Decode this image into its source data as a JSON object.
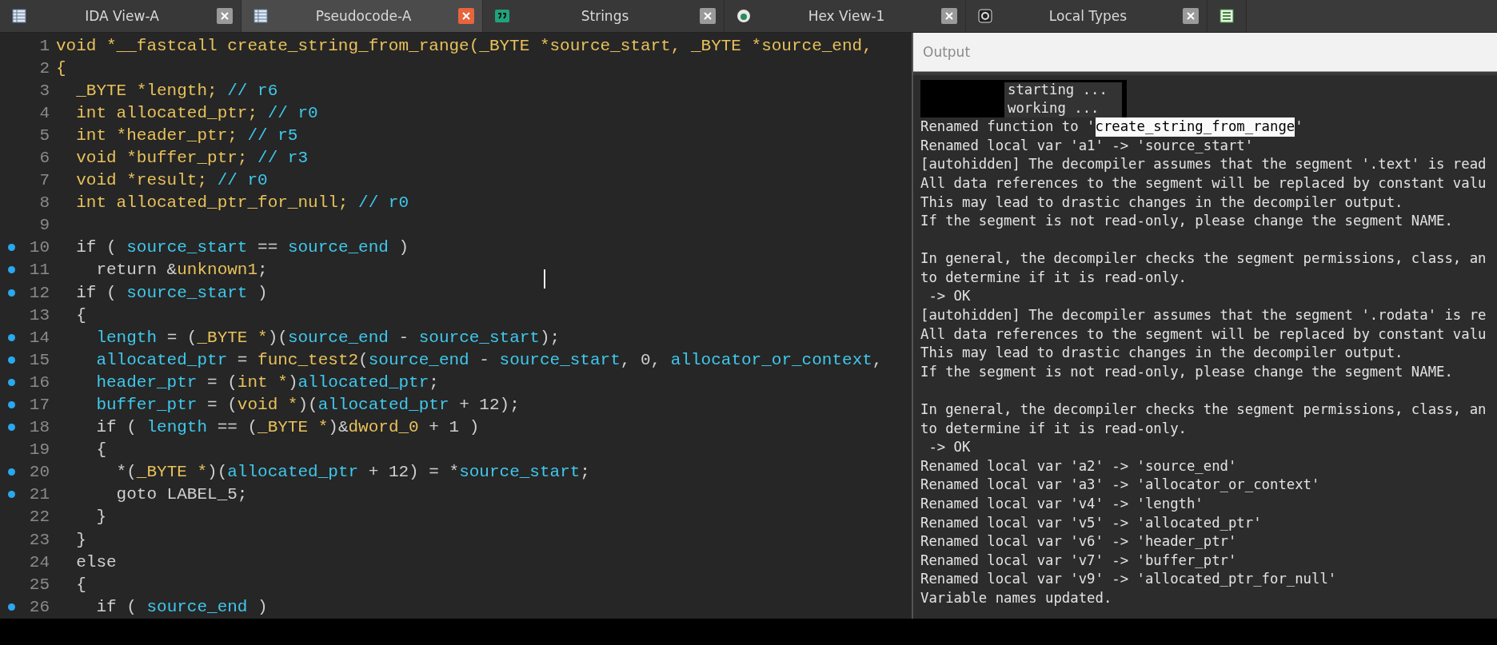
{
  "tabs": [
    {
      "label": "IDA View-A",
      "selected": false
    },
    {
      "label": "Pseudocode-A",
      "selected": true
    },
    {
      "label": "Strings",
      "selected": false
    },
    {
      "label": "Hex View-1",
      "selected": false
    },
    {
      "label": "Local Types",
      "selected": false
    },
    {
      "selected": false
    }
  ],
  "code": {
    "lines": [
      {
        "number": "1",
        "marked": false,
        "tokens": [
          {
            "kind": "type",
            "text": "void *__fastcall create_string_from_range(_BYTE *source_start, _BYTE *source_end,"
          }
        ]
      },
      {
        "number": "2",
        "marked": false,
        "tokens": [
          {
            "kind": "type",
            "text": "{"
          }
        ]
      },
      {
        "number": "3",
        "marked": false,
        "tokens": [
          {
            "kind": "type",
            "text": "  _BYTE *length; "
          },
          {
            "kind": "comment",
            "text": "// r6"
          }
        ]
      },
      {
        "number": "4",
        "marked": false,
        "tokens": [
          {
            "kind": "type",
            "text": "  int allocated_ptr; "
          },
          {
            "kind": "comment",
            "text": "// r0"
          }
        ]
      },
      {
        "number": "5",
        "marked": false,
        "tokens": [
          {
            "kind": "type",
            "text": "  int *header_ptr; "
          },
          {
            "kind": "comment",
            "text": "// r5"
          }
        ]
      },
      {
        "number": "6",
        "marked": false,
        "tokens": [
          {
            "kind": "type",
            "text": "  void *buffer_ptr; "
          },
          {
            "kind": "comment",
            "text": "// r3"
          }
        ]
      },
      {
        "number": "7",
        "marked": false,
        "tokens": [
          {
            "kind": "type",
            "text": "  void *result; "
          },
          {
            "kind": "comment",
            "text": "// r0"
          }
        ]
      },
      {
        "number": "8",
        "marked": false,
        "tokens": [
          {
            "kind": "type",
            "text": "  int allocated_ptr_for_null; "
          },
          {
            "kind": "comment",
            "text": "// r0"
          }
        ]
      },
      {
        "number": "9",
        "marked": false
      },
      {
        "number": "10",
        "marked": true,
        "tokens": [
          {
            "kind": "plain",
            "text": "  if ( "
          },
          {
            "kind": "var",
            "text": "source_start"
          },
          {
            "kind": "plain",
            "text": " == "
          },
          {
            "kind": "var",
            "text": "source_end"
          },
          {
            "kind": "plain",
            "text": " )"
          }
        ]
      },
      {
        "number": "11",
        "marked": true,
        "tokens": [
          {
            "kind": "plain",
            "text": "    return &"
          },
          {
            "kind": "type",
            "text": "unknown1"
          },
          {
            "kind": "plain",
            "text": ";"
          }
        ]
      },
      {
        "number": "12",
        "marked": true,
        "tokens": [
          {
            "kind": "plain",
            "text": "  if ( "
          },
          {
            "kind": "var",
            "text": "source_start"
          },
          {
            "kind": "plain",
            "text": " )"
          }
        ]
      },
      {
        "number": "13",
        "marked": false,
        "tokens": [
          {
            "kind": "plain",
            "text": "  {"
          }
        ]
      },
      {
        "number": "14",
        "marked": true,
        "tokens": [
          {
            "kind": "var",
            "text": "    length"
          },
          {
            "kind": "plain",
            "text": " = ("
          },
          {
            "kind": "type",
            "text": "_BYTE *"
          },
          {
            "kind": "plain",
            "text": ")("
          },
          {
            "kind": "var",
            "text": "source_end"
          },
          {
            "kind": "plain",
            "text": " - "
          },
          {
            "kind": "var",
            "text": "source_start"
          },
          {
            "kind": "plain",
            "text": ");"
          }
        ]
      },
      {
        "number": "15",
        "marked": true,
        "tokens": [
          {
            "kind": "var",
            "text": "    allocated_ptr"
          },
          {
            "kind": "plain",
            "text": " = "
          },
          {
            "kind": "type",
            "text": "func_test2"
          },
          {
            "kind": "plain",
            "text": "("
          },
          {
            "kind": "var",
            "text": "source_end"
          },
          {
            "kind": "plain",
            "text": " - "
          },
          {
            "kind": "var",
            "text": "source_start"
          },
          {
            "kind": "plain",
            "text": ", 0, "
          },
          {
            "kind": "var",
            "text": "allocator_or_context"
          },
          {
            "kind": "plain",
            "text": ","
          }
        ]
      },
      {
        "number": "16",
        "marked": true,
        "tokens": [
          {
            "kind": "var",
            "text": "    header_ptr"
          },
          {
            "kind": "plain",
            "text": " = ("
          },
          {
            "kind": "type",
            "text": "int *"
          },
          {
            "kind": "plain",
            "text": ")"
          },
          {
            "kind": "var",
            "text": "allocated_ptr"
          },
          {
            "kind": "plain",
            "text": ";"
          }
        ]
      },
      {
        "number": "17",
        "marked": true,
        "tokens": [
          {
            "kind": "var",
            "text": "    buffer_ptr"
          },
          {
            "kind": "plain",
            "text": " = ("
          },
          {
            "kind": "type",
            "text": "void *"
          },
          {
            "kind": "plain",
            "text": ")("
          },
          {
            "kind": "var",
            "text": "allocated_ptr"
          },
          {
            "kind": "plain",
            "text": " + 12);"
          }
        ]
      },
      {
        "number": "18",
        "marked": true,
        "tokens": [
          {
            "kind": "plain",
            "text": "    if ( "
          },
          {
            "kind": "var",
            "text": "length"
          },
          {
            "kind": "plain",
            "text": " == ("
          },
          {
            "kind": "type",
            "text": "_BYTE *"
          },
          {
            "kind": "plain",
            "text": ")&"
          },
          {
            "kind": "type",
            "text": "dword_0"
          },
          {
            "kind": "plain",
            "text": " + 1 )"
          }
        ]
      },
      {
        "number": "19",
        "marked": false,
        "tokens": [
          {
            "kind": "plain",
            "text": "    {"
          }
        ]
      },
      {
        "number": "20",
        "marked": true,
        "tokens": [
          {
            "kind": "plain",
            "text": "      *("
          },
          {
            "kind": "type",
            "text": "_BYTE *"
          },
          {
            "kind": "plain",
            "text": ")("
          },
          {
            "kind": "var",
            "text": "allocated_ptr"
          },
          {
            "kind": "plain",
            "text": " + 12) = *"
          },
          {
            "kind": "var",
            "text": "source_start"
          },
          {
            "kind": "plain",
            "text": ";"
          }
        ]
      },
      {
        "number": "21",
        "marked": true,
        "tokens": [
          {
            "kind": "plain",
            "text": "      goto LABEL_5;"
          }
        ]
      },
      {
        "number": "22",
        "marked": false,
        "tokens": [
          {
            "kind": "plain",
            "text": "    }"
          }
        ]
      },
      {
        "number": "23",
        "marked": false,
        "tokens": [
          {
            "kind": "plain",
            "text": "  }"
          }
        ]
      },
      {
        "number": "24",
        "marked": false,
        "tokens": [
          {
            "kind": "plain",
            "text": "  else"
          }
        ]
      },
      {
        "number": "25",
        "marked": false,
        "tokens": [
          {
            "kind": "plain",
            "text": "  {"
          }
        ]
      },
      {
        "number": "26",
        "marked": true,
        "tokens": [
          {
            "kind": "plain",
            "text": "    if ( "
          },
          {
            "kind": "var",
            "text": "source_end"
          },
          {
            "kind": "plain",
            "text": " )"
          }
        ]
      }
    ]
  },
  "output": {
    "title": "Output",
    "lines": [
      {
        "kind": "redacted",
        "text": "starting ..."
      },
      {
        "kind": "redacted",
        "text": "working ..."
      },
      {
        "kind": "selection",
        "parts": [
          {
            "text": "Renamed function to '",
            "selected": false
          },
          {
            "text": "create_string_from_range",
            "selected": true
          },
          {
            "text": "'",
            "selected": false
          }
        ]
      },
      {
        "kind": "plain",
        "text": "Renamed local var 'a1' -> 'source_start'"
      },
      {
        "kind": "plain",
        "text": "[autohidden] The decompiler assumes that the segment '.text' is read"
      },
      {
        "kind": "plain",
        "text": "All data references to the segment will be replaced by constant valu"
      },
      {
        "kind": "plain",
        "text": "This may lead to drastic changes in the decompiler output."
      },
      {
        "kind": "plain",
        "text": "If the segment is not read-only, please change the segment NAME."
      },
      {
        "kind": "blank"
      },
      {
        "kind": "plain",
        "text": "In general, the decompiler checks the segment permissions, class, an"
      },
      {
        "kind": "plain",
        "text": "to determine if it is read-only."
      },
      {
        "kind": "plain",
        "text": " -> OK"
      },
      {
        "kind": "plain",
        "text": "[autohidden] The decompiler assumes that the segment '.rodata' is re"
      },
      {
        "kind": "plain",
        "text": "All data references to the segment will be replaced by constant valu"
      },
      {
        "kind": "plain",
        "text": "This may lead to drastic changes in the decompiler output."
      },
      {
        "kind": "plain",
        "text": "If the segment is not read-only, please change the segment NAME."
      },
      {
        "kind": "blank"
      },
      {
        "kind": "plain",
        "text": "In general, the decompiler checks the segment permissions, class, an"
      },
      {
        "kind": "plain",
        "text": "to determine if it is read-only."
      },
      {
        "kind": "plain",
        "text": " -> OK"
      },
      {
        "kind": "plain",
        "text": "Renamed local var 'a2' -> 'source_end'"
      },
      {
        "kind": "plain",
        "text": "Renamed local var 'a3' -> 'allocator_or_context'"
      },
      {
        "kind": "plain",
        "text": "Renamed local var 'v4' -> 'length'"
      },
      {
        "kind": "plain",
        "text": "Renamed local var 'v5' -> 'allocated_ptr'"
      },
      {
        "kind": "plain",
        "text": "Renamed local var 'v6' -> 'header_ptr'"
      },
      {
        "kind": "plain",
        "text": "Renamed local var 'v7' -> 'buffer_ptr'"
      },
      {
        "kind": "plain",
        "text": "Renamed local var 'v9' -> 'allocated_ptr_for_null'"
      },
      {
        "kind": "plain",
        "text": "Variable names updated."
      }
    ]
  }
}
